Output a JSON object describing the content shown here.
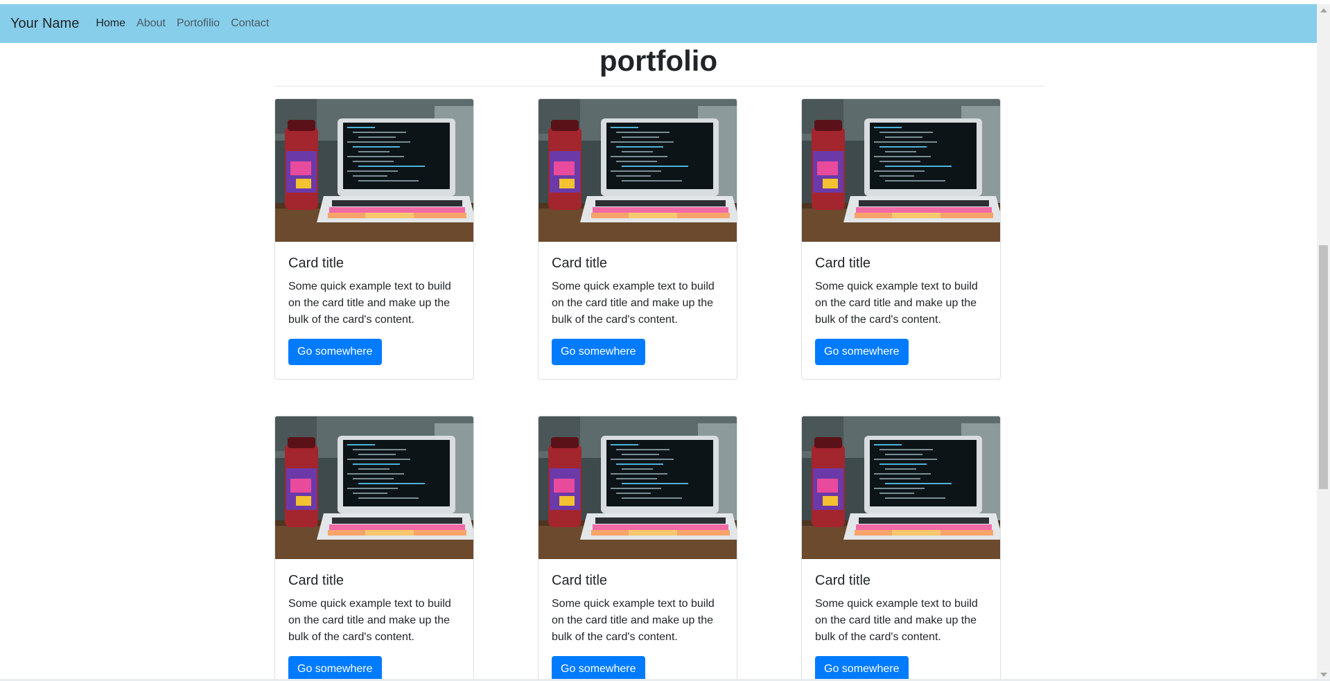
{
  "navbar": {
    "brand": "Your Name",
    "links": [
      {
        "label": "Home",
        "active": true
      },
      {
        "label": "About",
        "active": false
      },
      {
        "label": "Portofilio",
        "active": false
      },
      {
        "label": "Contact",
        "active": false
      }
    ]
  },
  "page": {
    "title": "portfolio"
  },
  "cards": [
    {
      "title": "Card title",
      "text": "Some quick example text to build on the card title and make up the bulk of the card's content.",
      "button": "Go somewhere"
    },
    {
      "title": "Card title",
      "text": "Some quick example text to build on the card title and make up the bulk of the card's content.",
      "button": "Go somewhere"
    },
    {
      "title": "Card title",
      "text": "Some quick example text to build on the card title and make up the bulk of the card's content.",
      "button": "Go somewhere"
    },
    {
      "title": "Card title",
      "text": "Some quick example text to build on the card title and make up the bulk of the card's content.",
      "button": "Go somewhere"
    },
    {
      "title": "Card title",
      "text": "Some quick example text to build on the card title and make up the bulk of the card's content.",
      "button": "Go somewhere"
    },
    {
      "title": "Card title",
      "text": "Some quick example text to build on the card title and make up the bulk of the card's content.",
      "button": "Go somewhere"
    }
  ],
  "colors": {
    "navbar_bg": "#87ceeb",
    "button_bg": "#007bff"
  }
}
